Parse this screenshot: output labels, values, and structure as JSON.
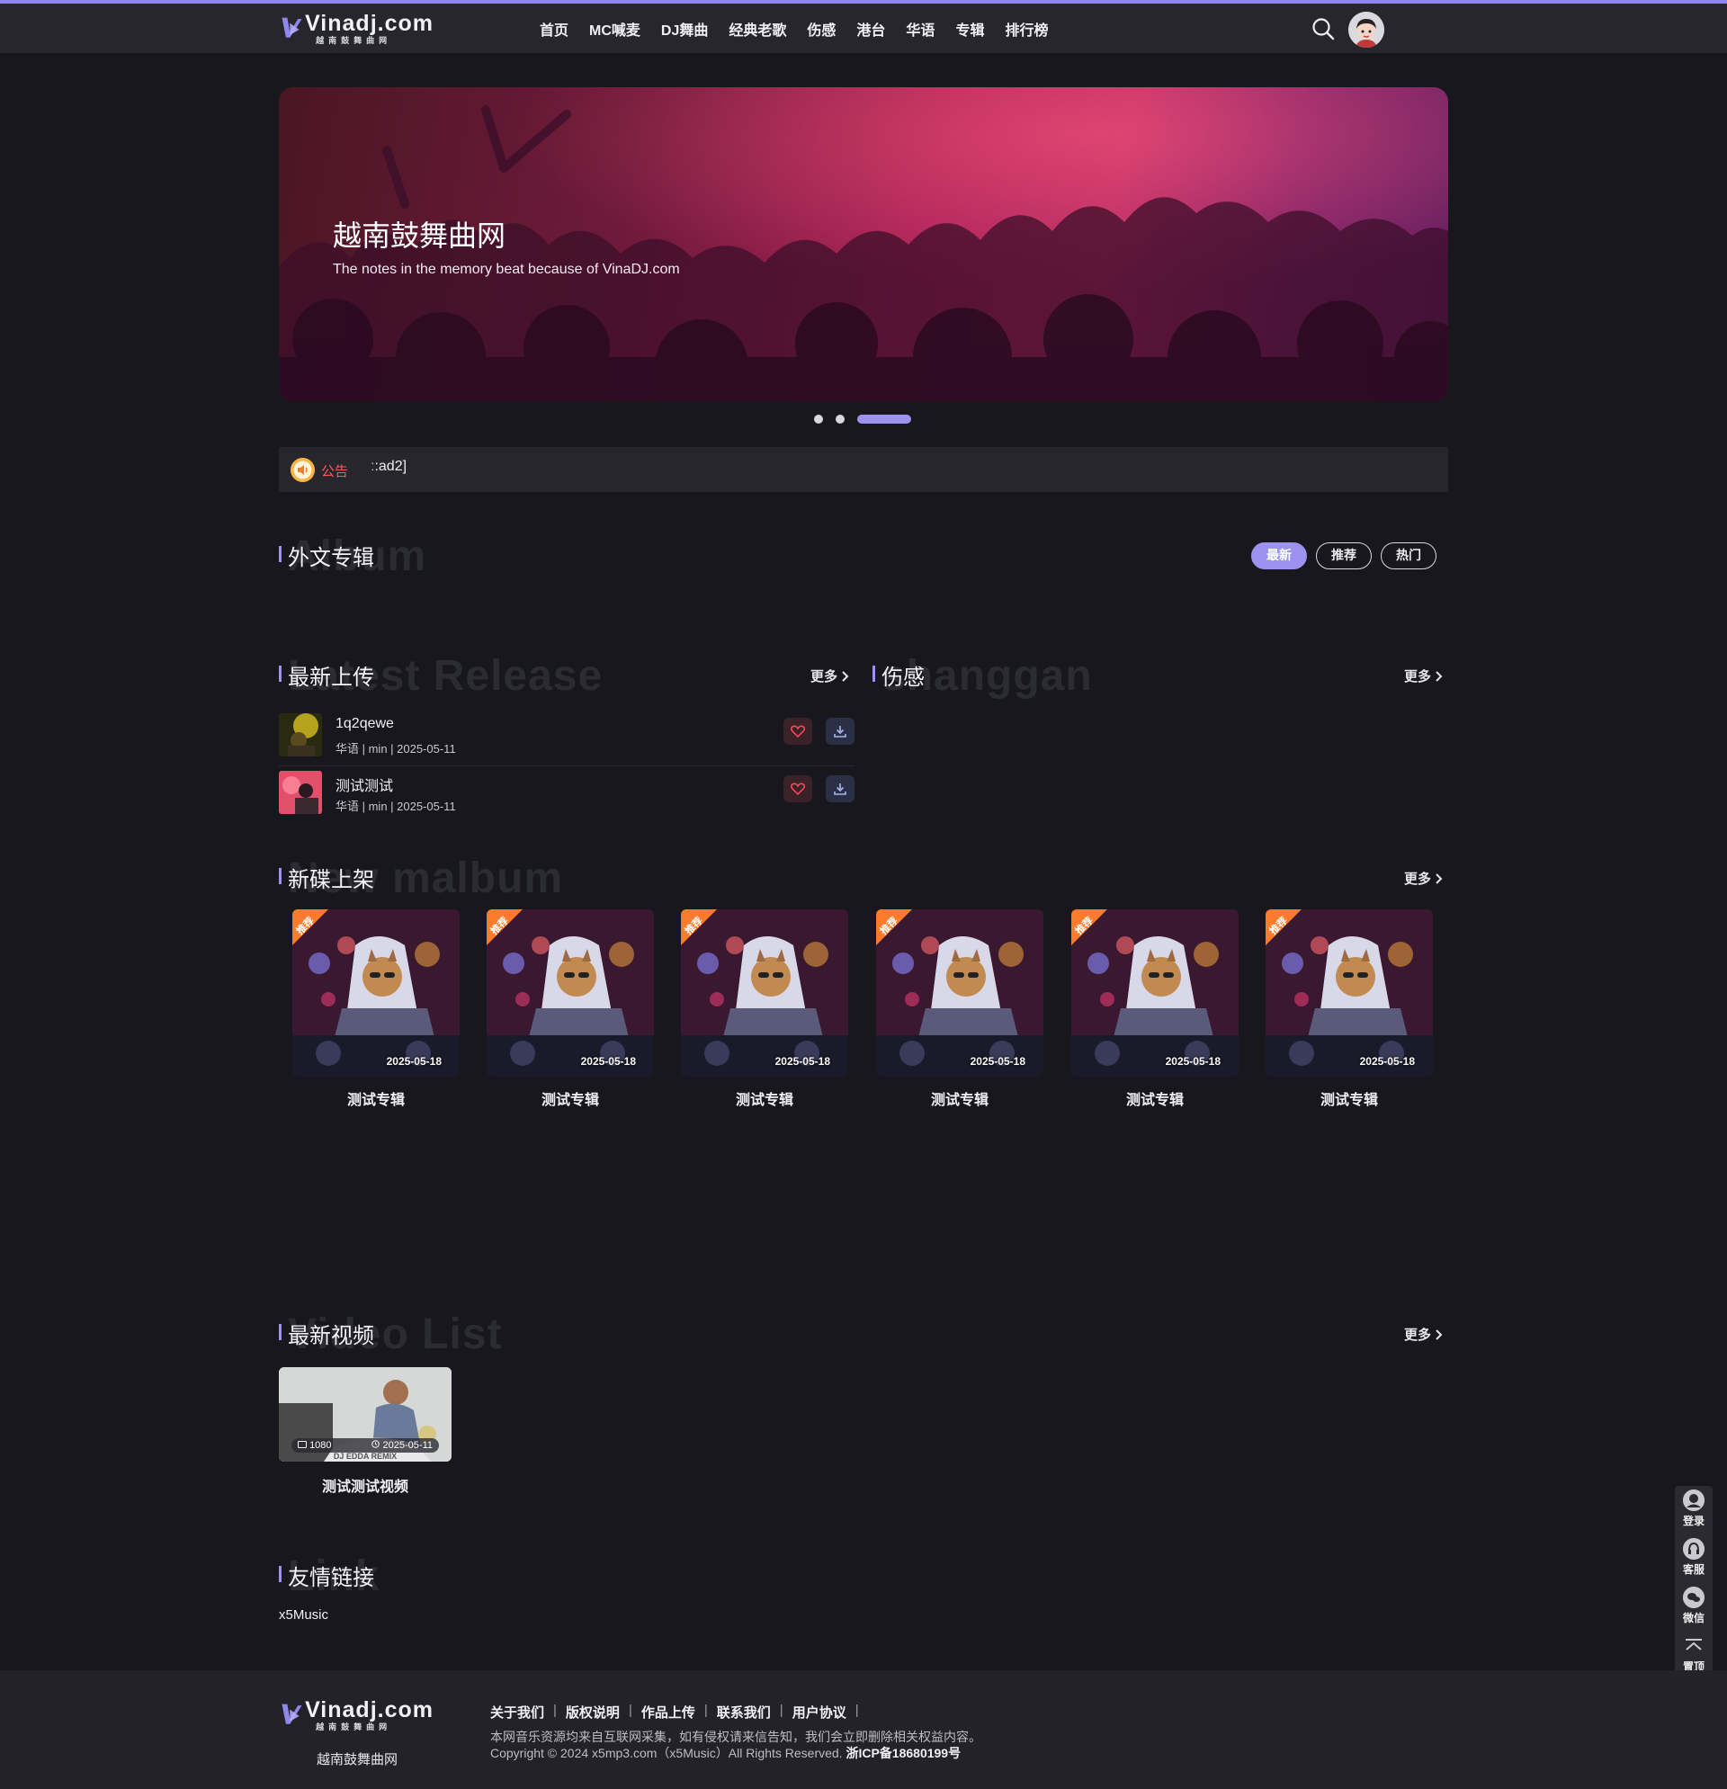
{
  "header": {
    "logo": {
      "text": "Vinadj.com",
      "subtitle": "越南鼓舞曲网"
    },
    "nav": [
      "首页",
      "MC喊麦",
      "DJ舞曲",
      "经典老歌",
      "伤感",
      "港台",
      "华语",
      "专辑",
      "排行榜"
    ]
  },
  "banner": {
    "title": "越南鼓舞曲网",
    "subtitle": "The notes in the memory beat because of VinaDJ.com",
    "slides": 3,
    "active_slide": 3
  },
  "notice": {
    "label": "公告",
    "text": "ː:ad2]"
  },
  "foreign_albums": {
    "bg_text": "Album",
    "title": "外文专辑",
    "tabs": [
      {
        "label": "最新",
        "active": true
      },
      {
        "label": "推荐",
        "active": false
      },
      {
        "label": "热门",
        "active": false
      }
    ]
  },
  "latest_upload": {
    "bg_text": "Latest Release",
    "title": "最新上传",
    "more": "更多",
    "songs": [
      {
        "title": "1q2qewe",
        "meta": "华语 | min | 2025-05-11"
      },
      {
        "title": "测试测试",
        "meta": "华语 | min | 2025-05-11"
      }
    ]
  },
  "sad": {
    "bg_text": "shanggan",
    "title": "伤感",
    "more": "更多"
  },
  "new_albums": {
    "bg_text": "New malbum",
    "title": "新碟上架",
    "more": "更多",
    "badge": "推荐",
    "items": [
      {
        "name": "测试专辑",
        "date": "2025-05-18"
      },
      {
        "name": "测试专辑",
        "date": "2025-05-18"
      },
      {
        "name": "测试专辑",
        "date": "2025-05-18"
      },
      {
        "name": "测试专辑",
        "date": "2025-05-18"
      },
      {
        "name": "测试专辑",
        "date": "2025-05-18"
      },
      {
        "name": "测试专辑",
        "date": "2025-05-18"
      }
    ]
  },
  "videos": {
    "bg_text": "Video List",
    "title": "最新视频",
    "more": "更多",
    "items": [
      {
        "name": "测试测试视频",
        "views": "1080",
        "date": "2025-05-11",
        "overlay": "DJ EDDA REMIX"
      }
    ]
  },
  "links": {
    "bg_text": "Link",
    "title": "友情链接",
    "items": [
      "x5Music"
    ]
  },
  "sidebar": [
    "登录",
    "客服",
    "微信",
    "置顶"
  ],
  "footer": {
    "logo_text": "Vinadj.com",
    "logo_sub": "越南鼓舞曲网",
    "site_name": "越南鼓舞曲网",
    "links": [
      "关于我们",
      "版权说明",
      "作品上传",
      "联系我们",
      "用户协议"
    ],
    "disclaimer": "本网音乐资源均来自互联网采集，如有侵权请来信告知，我们会立即删除相关权益内容。",
    "copyright": "Copyright © 2024 x5mp3.com（x5Music）All Rights Reserved.",
    "icp": "浙ICP备18680199号"
  },
  "colors": {
    "accent": "#9d92f0",
    "background": "#17171d",
    "header": "#26262c",
    "notice_red": "#ff5a5a"
  }
}
